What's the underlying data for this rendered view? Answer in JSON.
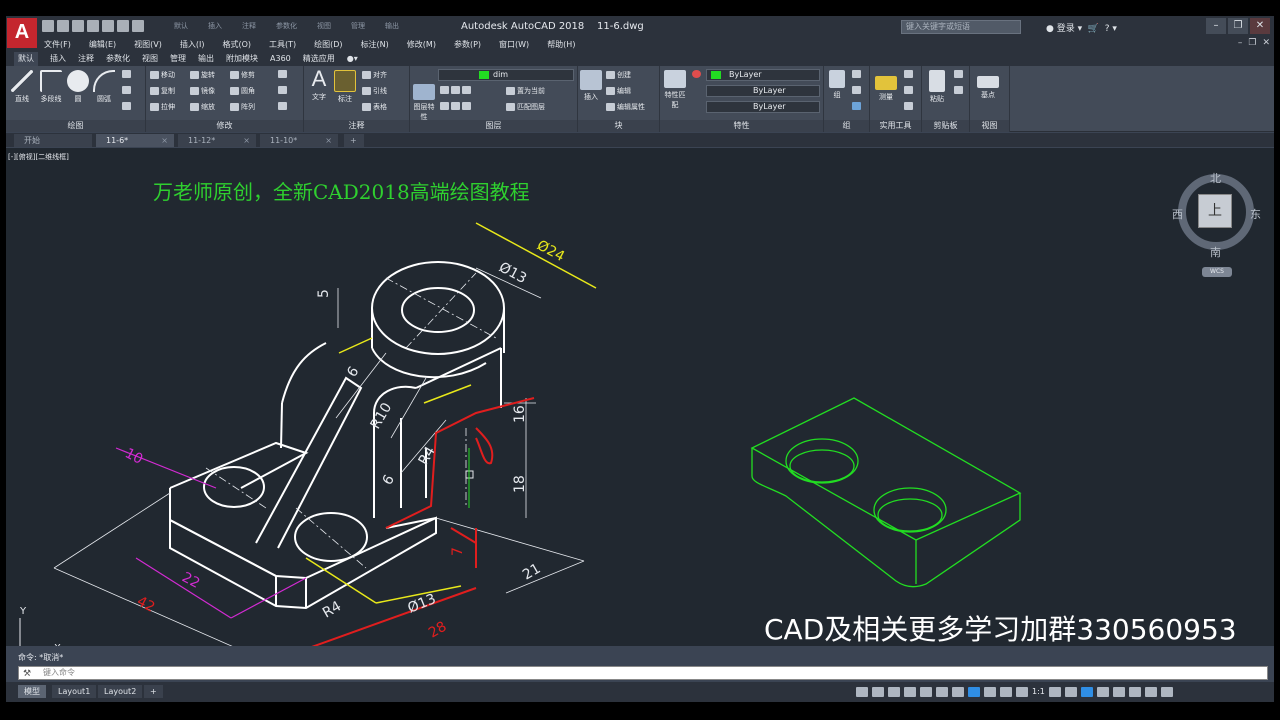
{
  "app": {
    "title": "Autodesk AutoCAD 2018",
    "file": "11-6.dwg",
    "logo": "A",
    "search_placeholder": "键入关键字或短语",
    "login": "登录",
    "title_menus": [
      "默认",
      "插入",
      "注释",
      "参数化",
      "视图",
      "管理",
      "输出",
      "附加模块",
      "A360",
      "精选应用"
    ]
  },
  "menubar": {
    "items": [
      "文件(F)",
      "编辑(E)",
      "视图(V)",
      "插入(I)",
      "格式(O)",
      "工具(T)",
      "绘图(D)",
      "标注(N)",
      "修改(M)",
      "参数(P)",
      "窗口(W)",
      "帮助(H)"
    ]
  },
  "ribbon_tabs": [
    "默认",
    "插入",
    "注释",
    "参数化",
    "视图",
    "管理",
    "输出",
    "附加模块",
    "A360",
    "精选应用"
  ],
  "ribbon": {
    "draw": {
      "title": "绘图",
      "big": [
        "直线",
        "多段线",
        "圆",
        "圆弧"
      ]
    },
    "modify": {
      "title": "修改",
      "items": [
        "移动",
        "旋转",
        "修剪",
        "复制",
        "镜像",
        "圆角",
        "拉伸",
        "缩放",
        "阵列"
      ]
    },
    "annotation": {
      "title": "注释",
      "big": [
        "文字",
        "标注"
      ],
      "items": [
        "对齐",
        "引线",
        "表格"
      ]
    },
    "layers": {
      "title": "图层",
      "big": "图层特性",
      "current_layer": "dim",
      "items": [
        "置为当前",
        "匹配图层"
      ]
    },
    "block": {
      "title": "块",
      "big": "插入",
      "items": [
        "创建",
        "编辑",
        "编辑属性"
      ]
    },
    "properties": {
      "title": "特性",
      "big": "特性匹配",
      "color": "ByLayer",
      "linetype": "ByLayer",
      "lineweight": "ByLayer"
    },
    "groups": {
      "title": "组",
      "big": "组"
    },
    "utilities": {
      "title": "实用工具",
      "big": "测量"
    },
    "clipboard": {
      "title": "剪贴板",
      "big": "粘贴"
    },
    "view": {
      "title": "视图",
      "big": "基点"
    }
  },
  "file_tabs": [
    {
      "label": "开始"
    },
    {
      "label": "11-6*"
    },
    {
      "label": "11-12*"
    },
    {
      "label": "11-10*"
    }
  ],
  "canvas": {
    "view_label": "[-][俯视][二维线框]",
    "title_note": "万老师原创，全新CAD2018高端绘图教程",
    "promo": "CAD及相关更多学习加群330560953",
    "viewcube": {
      "north": "北",
      "south": "南",
      "east": "东",
      "west": "西",
      "face": "上",
      "wcs": "WCS"
    },
    "ucs": {
      "x": "X",
      "y": "Y"
    },
    "dims": {
      "phi24": "Ø24",
      "phi13_top": "Ø13",
      "d5": "5",
      "d6a": "6",
      "r10": "R10",
      "r4a": "R4",
      "d16": "16",
      "d18": "18",
      "d6b": "6",
      "d10": "10",
      "d22": "22",
      "d42": "42",
      "r4b": "R4",
      "phi13_bot": "Ø13",
      "d28": "28",
      "d21": "21",
      "d7": "7"
    }
  },
  "command": {
    "history": "命令: *取消*",
    "placeholder": "键入命令"
  },
  "layout_tabs": [
    "模型",
    "Layout1",
    "Layout2",
    "+"
  ],
  "status": {
    "scale": "1:1"
  },
  "colors": {
    "dim_yellow": "#e8e81a",
    "dim_magenta": "#d22bd2",
    "dim_red": "#e01e1e",
    "green": "#22dd22",
    "white": "#ffffff",
    "canvas_bg": "#212830"
  }
}
